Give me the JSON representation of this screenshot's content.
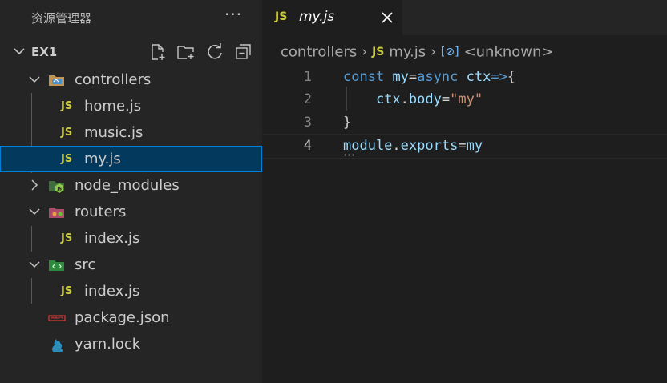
{
  "explorer": {
    "title": "资源管理器",
    "more_label": "···",
    "section": "EX1",
    "actions": [
      "new-file",
      "new-folder",
      "refresh",
      "collapse-all"
    ],
    "tree": [
      {
        "label": "controllers",
        "type": "folder",
        "expanded": true,
        "icon": "controllers-folder-icon"
      },
      {
        "label": "home.js",
        "type": "file",
        "icon_text": "JS"
      },
      {
        "label": "music.js",
        "type": "file",
        "icon_text": "JS"
      },
      {
        "label": "my.js",
        "type": "file",
        "icon_text": "JS",
        "selected": true
      },
      {
        "label": "node_modules",
        "type": "folder",
        "expanded": false,
        "icon": "node-folder-icon"
      },
      {
        "label": "routers",
        "type": "folder",
        "expanded": true,
        "icon": "routers-folder-icon"
      },
      {
        "label": "index.js",
        "type": "file",
        "icon_text": "JS"
      },
      {
        "label": "src",
        "type": "folder",
        "expanded": true,
        "icon": "src-folder-icon"
      },
      {
        "label": "index.js",
        "type": "file",
        "icon_text": "JS"
      },
      {
        "label": "package.json",
        "type": "file",
        "icon": "npm-icon"
      },
      {
        "label": "yarn.lock",
        "type": "file",
        "icon": "yarn-icon"
      }
    ]
  },
  "tab": {
    "icon_text": "JS",
    "label": "my.js"
  },
  "breadcrumb": {
    "folder": "controllers",
    "file_icon_text": "JS",
    "file": "my.js",
    "symbol_icon_text": "[⊘]",
    "symbol": "<unknown>"
  },
  "editor": {
    "active_line": 4,
    "lines": [
      {
        "number": "1",
        "tokens": [
          {
            "t": "const",
            "c": "kw"
          },
          {
            "t": " ",
            "c": "plain"
          },
          {
            "t": "my",
            "c": "var"
          },
          {
            "t": "=",
            "c": "op"
          },
          {
            "t": "async",
            "c": "kw"
          },
          {
            "t": " ",
            "c": "plain"
          },
          {
            "t": "ctx",
            "c": "var"
          },
          {
            "t": "=>",
            "c": "kw"
          },
          {
            "t": "{",
            "c": "plain"
          }
        ]
      },
      {
        "number": "2",
        "tokens": [
          {
            "t": "    ",
            "c": "plain"
          },
          {
            "t": "ctx",
            "c": "var"
          },
          {
            "t": ".",
            "c": "op"
          },
          {
            "t": "body",
            "c": "var"
          },
          {
            "t": "=",
            "c": "op"
          },
          {
            "t": "\"my\"",
            "c": "str"
          }
        ]
      },
      {
        "number": "3",
        "tokens": [
          {
            "t": "}",
            "c": "plain"
          }
        ]
      },
      {
        "number": "4",
        "tokens": [
          {
            "t": "module",
            "c": "var"
          },
          {
            "t": ".",
            "c": "op"
          },
          {
            "t": "exports",
            "c": "var"
          },
          {
            "t": "=",
            "c": "op"
          },
          {
            "t": "my",
            "c": "var"
          }
        ]
      }
    ]
  }
}
